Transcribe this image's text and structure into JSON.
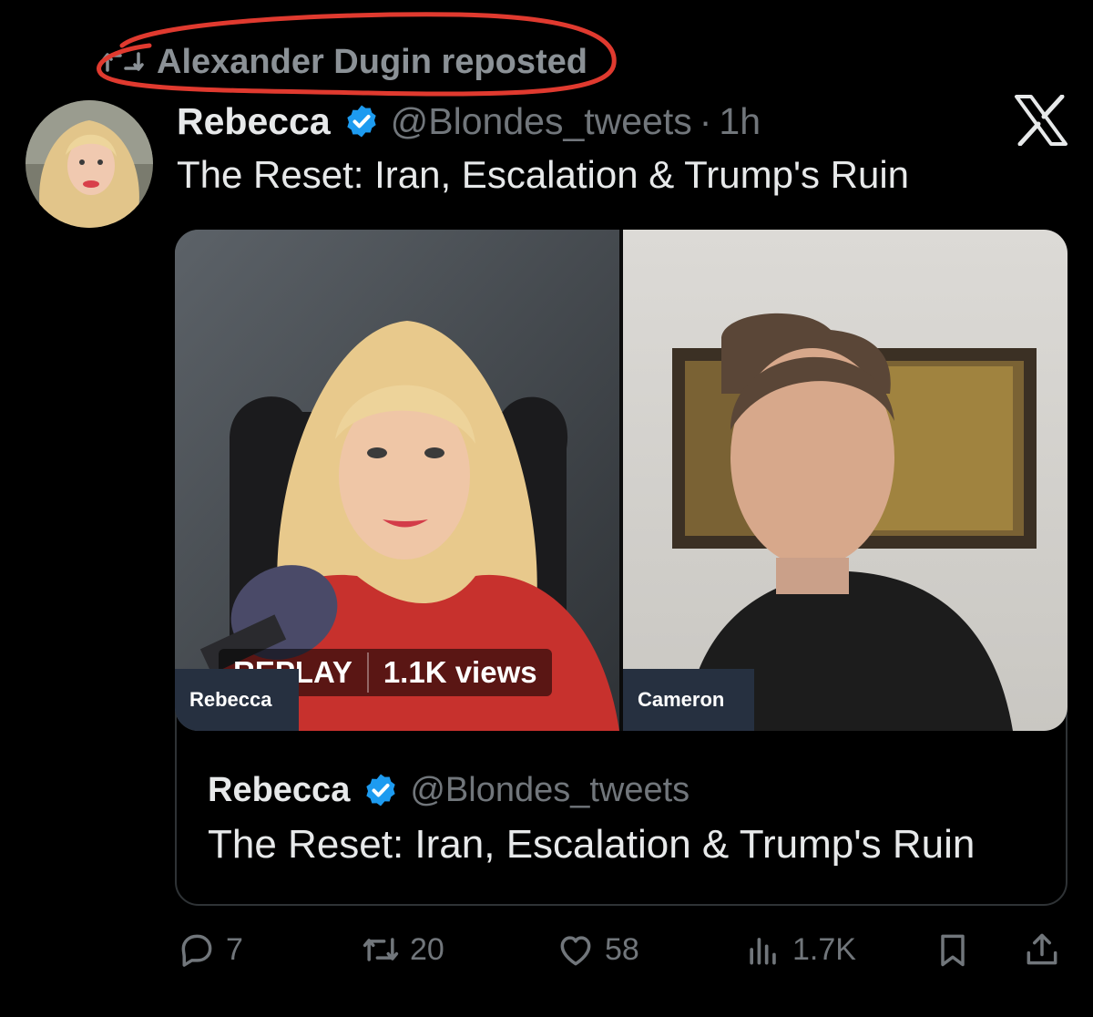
{
  "repost": {
    "label": "Alexander Dugin reposted"
  },
  "post": {
    "author": "Rebecca",
    "handle": "@Blondes_tweets",
    "separator": "·",
    "time": "1h",
    "text": "The Reset: Iran, Escalation & Trump's Ruin"
  },
  "media": {
    "badge_replay": "REPLAY",
    "badge_views": "1.1K views",
    "left_tag": "Rebecca",
    "right_tag": "Cameron"
  },
  "quote": {
    "author": "Rebecca",
    "handle": "@Blondes_tweets",
    "text": "The Reset: Iran, Escalation & Trump's Ruin"
  },
  "actions": {
    "replies": "7",
    "reposts": "20",
    "likes": "58",
    "views": "1.7K"
  },
  "colors": {
    "background": "#000000",
    "text": "#e7e9ea",
    "muted": "#71767b",
    "verified": "#1d9bf0",
    "annotation": "#e03a2f"
  },
  "icons": [
    "repost-icon",
    "verified-badge-icon",
    "x-logo-icon",
    "reply-icon",
    "retweet-icon",
    "like-icon",
    "views-icon",
    "bookmark-icon",
    "share-icon"
  ]
}
